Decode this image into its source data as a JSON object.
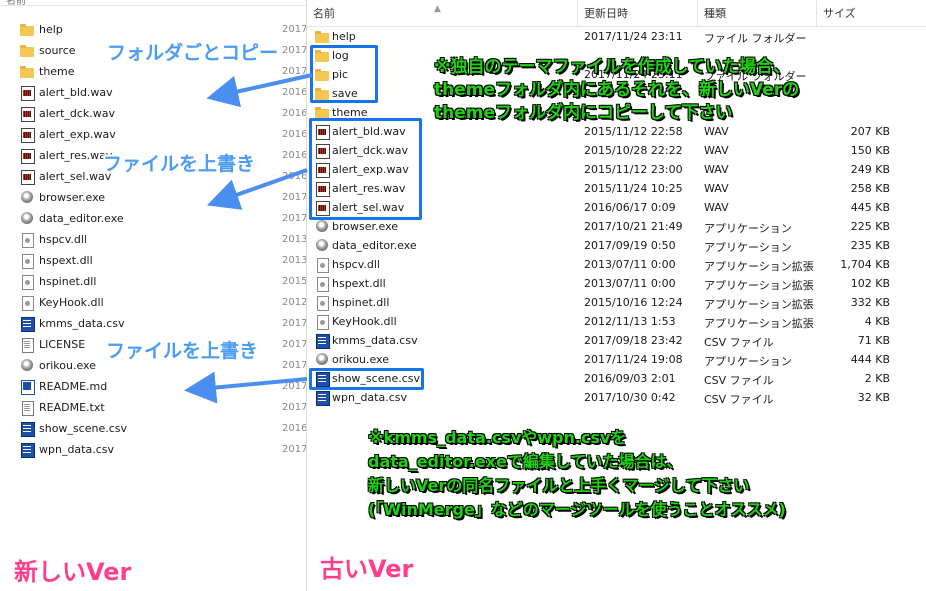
{
  "left_pane": {
    "header_label": "名前",
    "rows": [
      {
        "icon": "folder-icon",
        "name": "help",
        "date_clip": "2017"
      },
      {
        "icon": "folder-icon",
        "name": "source",
        "date_clip": "2017"
      },
      {
        "icon": "folder-icon",
        "name": "theme",
        "date_clip": "2017"
      },
      {
        "icon": "wav-file-icon",
        "name": "alert_bld.wav",
        "date_clip": "2016"
      },
      {
        "icon": "wav-file-icon",
        "name": "alert_dck.wav",
        "date_clip": "2016"
      },
      {
        "icon": "wav-file-icon",
        "name": "alert_exp.wav",
        "date_clip": "2016"
      },
      {
        "icon": "wav-file-icon",
        "name": "alert_res.wav",
        "date_clip": "2016"
      },
      {
        "icon": "wav-file-icon",
        "name": "alert_sel.wav",
        "date_clip": "2016"
      },
      {
        "icon": "exe-file-icon",
        "name": "browser.exe",
        "date_clip": "2017"
      },
      {
        "icon": "exe-file-icon",
        "name": "data_editor.exe",
        "date_clip": "2017"
      },
      {
        "icon": "dll-file-icon",
        "name": "hspcv.dll",
        "date_clip": "2013"
      },
      {
        "icon": "dll-file-icon",
        "name": "hspext.dll",
        "date_clip": "2013"
      },
      {
        "icon": "dll-file-icon",
        "name": "hspinet.dll",
        "date_clip": "2015"
      },
      {
        "icon": "dll-file-icon",
        "name": "KeyHook.dll",
        "date_clip": "2012"
      },
      {
        "icon": "csv-file-icon",
        "name": "kmms_data.csv",
        "date_clip": "2017"
      },
      {
        "icon": "text-file-icon",
        "name": "LICENSE",
        "date_clip": "2017"
      },
      {
        "icon": "exe-file-icon",
        "name": "orikou.exe",
        "date_clip": "2017"
      },
      {
        "icon": "md-file-icon",
        "name": "README.md",
        "date_clip": "2017"
      },
      {
        "icon": "text-file-icon",
        "name": "README.txt",
        "date_clip": "2017"
      },
      {
        "icon": "csv-file-icon",
        "name": "show_scene.csv",
        "date_clip": "2016"
      },
      {
        "icon": "csv-file-icon",
        "name": "wpn_data.csv",
        "date_clip": "2017"
      }
    ]
  },
  "right_pane": {
    "columns": {
      "name": "名前",
      "date": "更新日時",
      "type": "種類",
      "size": "サイズ"
    },
    "rows": [
      {
        "icon": "folder-icon",
        "name": "help",
        "date": "2017/11/24 23:11",
        "type": "ファイル フォルダー",
        "size": ""
      },
      {
        "icon": "folder-icon",
        "name": "log",
        "date": "",
        "type": "",
        "size": ""
      },
      {
        "icon": "folder-icon",
        "name": "pic",
        "date": "2017/11/24 23:11",
        "type": "ファイル フォルダー",
        "size": ""
      },
      {
        "icon": "folder-icon",
        "name": "save",
        "date": "",
        "type": "",
        "size": ""
      },
      {
        "icon": "folder-icon",
        "name": "theme",
        "date": "",
        "type": "",
        "size": ""
      },
      {
        "icon": "wav-file-icon",
        "name": "alert_bld.wav",
        "date": "2015/11/12 22:58",
        "type": "WAV",
        "size": "207 KB"
      },
      {
        "icon": "wav-file-icon",
        "name": "alert_dck.wav",
        "date": "2015/10/28 22:22",
        "type": "WAV",
        "size": "150 KB"
      },
      {
        "icon": "wav-file-icon",
        "name": "alert_exp.wav",
        "date": "2015/11/12 23:00",
        "type": "WAV",
        "size": "249 KB"
      },
      {
        "icon": "wav-file-icon",
        "name": "alert_res.wav",
        "date": "2015/11/24 10:25",
        "type": "WAV",
        "size": "258 KB"
      },
      {
        "icon": "wav-file-icon",
        "name": "alert_sel.wav",
        "date": "2016/06/17 0:09",
        "type": "WAV",
        "size": "445 KB"
      },
      {
        "icon": "exe-file-icon",
        "name": "browser.exe",
        "date": "2017/10/21 21:49",
        "type": "アプリケーション",
        "size": "225 KB"
      },
      {
        "icon": "exe-file-icon",
        "name": "data_editor.exe",
        "date": "2017/09/19 0:50",
        "type": "アプリケーション",
        "size": "235 KB"
      },
      {
        "icon": "dll-file-icon",
        "name": "hspcv.dll",
        "date": "2013/07/11 0:00",
        "type": "アプリケーション拡張",
        "size": "1,704 KB"
      },
      {
        "icon": "dll-file-icon",
        "name": "hspext.dll",
        "date": "2013/07/11 0:00",
        "type": "アプリケーション拡張",
        "size": "102 KB"
      },
      {
        "icon": "dll-file-icon",
        "name": "hspinet.dll",
        "date": "2015/10/16 12:24",
        "type": "アプリケーション拡張",
        "size": "332 KB"
      },
      {
        "icon": "dll-file-icon",
        "name": "KeyHook.dll",
        "date": "2012/11/13 1:53",
        "type": "アプリケーション拡張",
        "size": "4 KB"
      },
      {
        "icon": "csv-file-icon",
        "name": "kmms_data.csv",
        "date": "2017/09/18 23:42",
        "type": "CSV ファイル",
        "size": "71 KB"
      },
      {
        "icon": "exe-file-icon",
        "name": "orikou.exe",
        "date": "2017/11/24 19:08",
        "type": "アプリケーション",
        "size": "444 KB"
      },
      {
        "icon": "csv-file-icon",
        "name": "show_scene.csv",
        "date": "2016/09/03 2:01",
        "type": "CSV ファイル",
        "size": "2 KB"
      },
      {
        "icon": "csv-file-icon",
        "name": "wpn_data.csv",
        "date": "2017/10/30 0:42",
        "type": "CSV ファイル",
        "size": "32 KB"
      }
    ]
  },
  "annotations": {
    "folder_copy_label": "フォルダごとコピー",
    "overwrite_label_1": "ファイルを上書き",
    "overwrite_label_2": "ファイルを上書き",
    "theme_note": [
      "※独自のテーマファイルを作成していた場合、",
      "themeフォルダ内にあるそれを、新しいVerの",
      "themeフォルダ内にコピーして下さい"
    ],
    "merge_note": [
      "※kmms_data.csvやwpn.csvを",
      "data_editor.exeで編集していた場合は、",
      "新しいVerの同名ファイルと上手くマージして下さい",
      "(「WinMerge」などのマージツールを使うことオススメ)"
    ],
    "new_version_label": "新しいVer",
    "old_version_label": "古いVer"
  },
  "colors": {
    "highlight_blue": "#1874e8",
    "callout_blue": "#4a9cf5",
    "note_green": "#1fd20f",
    "version_pink": "#ff3f8e",
    "folder_yellow": "#f4c752"
  }
}
